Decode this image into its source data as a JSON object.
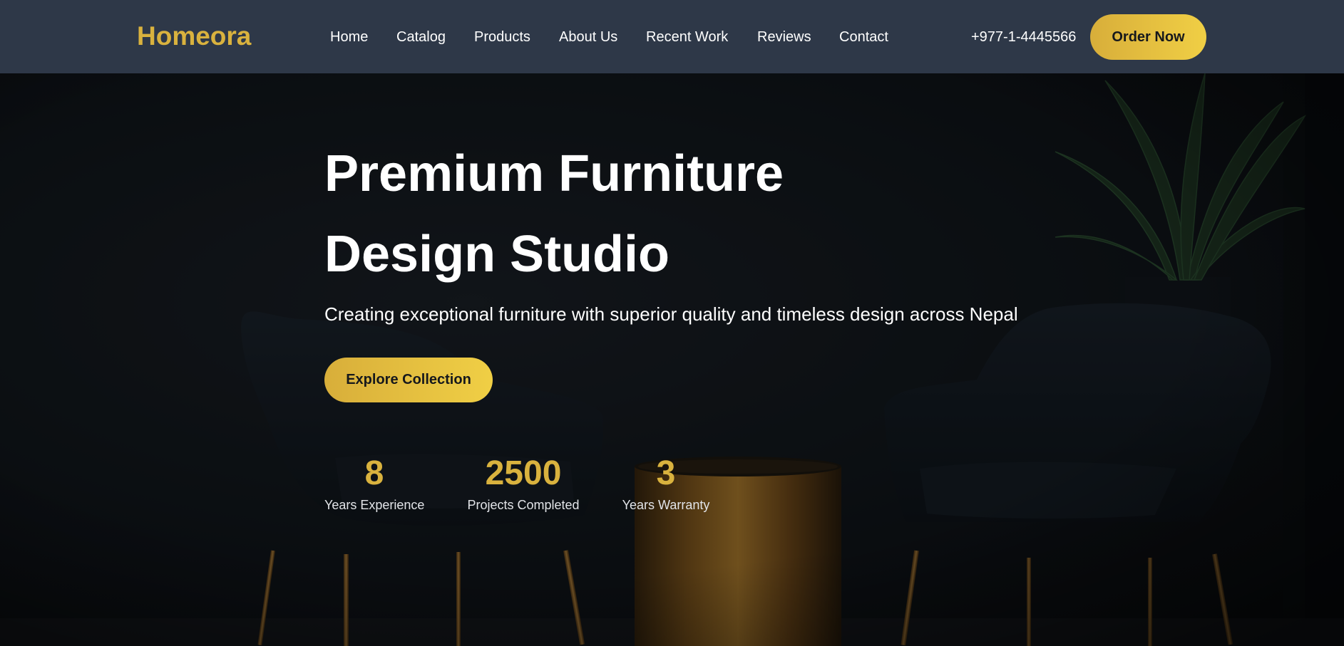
{
  "brand": {
    "name": "Homeora"
  },
  "nav": {
    "links": [
      {
        "label": "Home"
      },
      {
        "label": "Catalog"
      },
      {
        "label": "Products"
      },
      {
        "label": "About Us"
      },
      {
        "label": "Recent Work"
      },
      {
        "label": "Reviews"
      },
      {
        "label": "Contact"
      }
    ],
    "phone": "+977-1-4445566",
    "cta_label": "Order Now"
  },
  "hero": {
    "title_line1": "Premium Furniture",
    "title_line2": "Design Studio",
    "subtitle": "Creating exceptional furniture with superior quality and timeless design across Nepal",
    "cta_label": "Explore Collection",
    "stats": [
      {
        "value": "8",
        "label": "Years Experience"
      },
      {
        "value": "2500",
        "label": "Projects Completed"
      },
      {
        "value": "3",
        "label": "Years Warranty"
      }
    ]
  },
  "colors": {
    "accent": "#d9b23e",
    "navbar_bg": "#2e3848",
    "hero_bg": "#0e1216"
  }
}
